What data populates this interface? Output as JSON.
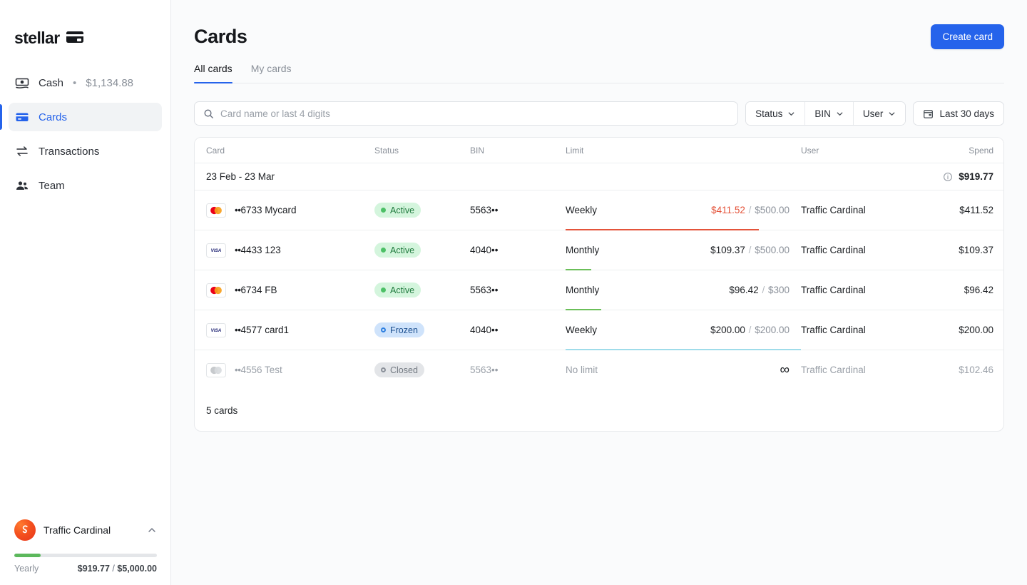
{
  "brand": {
    "name": "stellar",
    "mark_icon": "credit-card-icon"
  },
  "sidebar": {
    "items": [
      {
        "icon": "cash-icon",
        "label": "Cash",
        "separator": "•",
        "value": "$1,134.88",
        "active": false
      },
      {
        "icon": "credit-card-icon",
        "label": "Cards",
        "active": true
      },
      {
        "icon": "transactions-arrows-icon",
        "label": "Transactions",
        "active": false
      },
      {
        "icon": "team-people-icon",
        "label": "Team",
        "active": false
      }
    ],
    "account": {
      "name": "Traffic Cardinal",
      "avatar_icon": "account-avatar",
      "chevron_icon": "chevron-up-icon",
      "period_label": "Yearly",
      "spent": "$919.77",
      "separator": "/",
      "total": "$5,000.00",
      "progress_percent": 18.4,
      "progress_color": "#5cb85c"
    }
  },
  "header": {
    "title": "Cards",
    "create_button": "Create card"
  },
  "tabs": [
    {
      "label": "All cards",
      "active": true
    },
    {
      "label": "My cards",
      "active": false
    }
  ],
  "filters": {
    "search": {
      "placeholder": "Card name or last 4 digits",
      "value": "",
      "icon": "search-icon"
    },
    "buttons": [
      {
        "label": "Status",
        "icon": "chevron-down-icon"
      },
      {
        "label": "BIN",
        "icon": "chevron-down-icon"
      },
      {
        "label": "User",
        "icon": "chevron-down-icon"
      }
    ],
    "date_range": {
      "label": "Last 30 days",
      "icon": "calendar-icon"
    }
  },
  "table": {
    "columns": [
      "Card",
      "Status",
      "BIN",
      "Limit",
      "User",
      "Spend"
    ],
    "date_group": {
      "range": "23 Feb - 23 Mar",
      "info_icon": "info-icon",
      "total": "$919.77"
    },
    "rows": [
      {
        "brand_icon": "mastercard-icon",
        "card_dots": "••",
        "card_name": "6733 Mycard",
        "status": {
          "label": "Active",
          "kind": "active",
          "dot_icon": "status-dot-icon"
        },
        "bin": "5563••",
        "limit_period": "Weekly",
        "limit_used": "$411.52",
        "limit_separator": "/",
        "limit_cap": "$500.00",
        "limit_over": true,
        "limit_percent": 82,
        "limit_color": "#e4533a",
        "user": "Traffic Cardinal",
        "spend": "$411.52",
        "dimmed": false
      },
      {
        "brand_icon": "visa-icon",
        "card_dots": "••",
        "card_name": "4433 123",
        "status": {
          "label": "Active",
          "kind": "active",
          "dot_icon": "status-dot-icon"
        },
        "bin": "4040••",
        "limit_period": "Monthly",
        "limit_used": "$109.37",
        "limit_separator": "/",
        "limit_cap": "$500.00",
        "limit_over": false,
        "limit_percent": 11,
        "limit_color": "#6bbf59",
        "user": "Traffic Cardinal",
        "spend": "$109.37",
        "dimmed": false
      },
      {
        "brand_icon": "mastercard-icon",
        "card_dots": "••",
        "card_name": "6734 FB",
        "status": {
          "label": "Active",
          "kind": "active",
          "dot_icon": "status-dot-icon"
        },
        "bin": "5563••",
        "limit_period": "Monthly",
        "limit_used": "$96.42",
        "limit_separator": "/",
        "limit_cap": "$300",
        "limit_over": false,
        "limit_percent": 15,
        "limit_color": "#6bbf59",
        "user": "Traffic Cardinal",
        "spend": "$96.42",
        "dimmed": false
      },
      {
        "brand_icon": "visa-icon",
        "card_dots": "••",
        "card_name": "4577 card1",
        "status": {
          "label": "Frozen",
          "kind": "frozen",
          "dot_icon": "status-ring-icon"
        },
        "bin": "4040••",
        "limit_period": "Weekly",
        "limit_used": "$200.00",
        "limit_separator": "/",
        "limit_cap": "$200.00",
        "limit_over": false,
        "limit_percent": 100,
        "limit_color": "#9fdcea",
        "user": "Traffic Cardinal",
        "spend": "$200.00",
        "dimmed": false
      },
      {
        "brand_icon": "mastercard-grey-icon",
        "card_dots": "••",
        "card_name": "4556 Test",
        "status": {
          "label": "Closed",
          "kind": "closed",
          "dot_icon": "status-ring-icon"
        },
        "bin": "5563••",
        "limit_period": "No limit",
        "limit_used": "",
        "limit_separator": "",
        "limit_cap": "",
        "limit_infinity": "∞",
        "limit_over": false,
        "limit_percent": 0,
        "limit_color": "transparent",
        "user": "Traffic Cardinal",
        "spend": "$102.46",
        "dimmed": true
      }
    ],
    "footer": "5 cards"
  },
  "colors": {
    "accent": "#2563eb",
    "over_limit": "#e4533a",
    "ok": "#6bbf59",
    "frozen": "#9fdcea",
    "page_bg": "#fafbfc"
  }
}
